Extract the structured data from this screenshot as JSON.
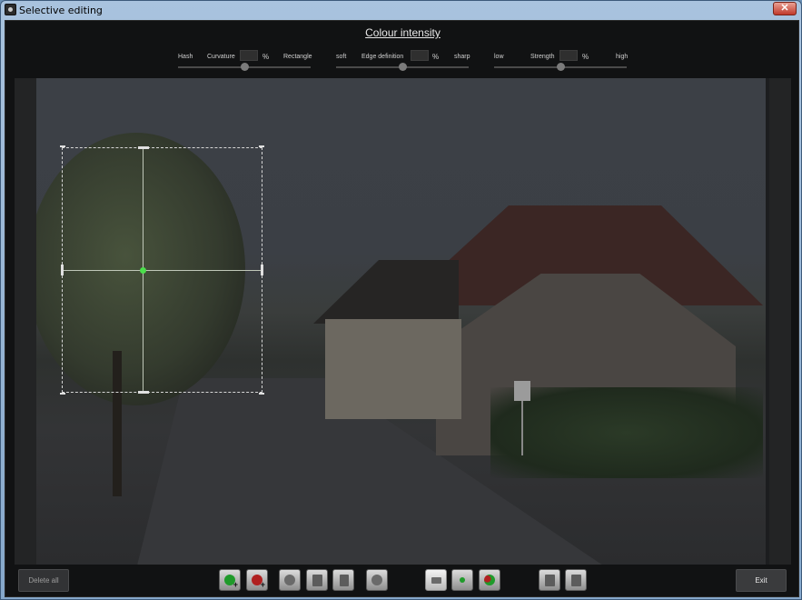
{
  "window": {
    "title": "Selective editing",
    "close_glyph": "✕"
  },
  "heading": "Colour intensity",
  "sliders": {
    "curvature": {
      "left_label": "Hash",
      "label": "Curvature",
      "unit": "%",
      "right_label": "Rectangle",
      "value": 0.5
    },
    "edge_definition": {
      "left_label": "soft",
      "label": "Edge definition",
      "unit": "%",
      "right_label": "sharp",
      "value": 0.5
    },
    "strength": {
      "left_label": "low",
      "label": "Strength",
      "unit": "%",
      "right_label": "high",
      "value": 0.5
    }
  },
  "footer": {
    "delete_all_label": "Delete all",
    "exit_label": "Exit",
    "tools": [
      {
        "icon": "add-green-point-icon"
      },
      {
        "icon": "add-red-point-icon"
      },
      {
        "icon": "zoom-region-icon"
      },
      {
        "icon": "copy-region-icon"
      },
      {
        "icon": "delete-region-icon"
      },
      {
        "icon": "region-settings-icon"
      },
      {
        "icon": "rectangle-mode-icon"
      },
      {
        "icon": "green-point-mode-icon"
      },
      {
        "icon": "multi-point-mode-icon"
      },
      {
        "icon": "export-icon"
      },
      {
        "icon": "info-icon"
      }
    ]
  },
  "colors": {
    "accent_green": "#4be04b",
    "accent_red": "#c0392b",
    "background": "#111213"
  }
}
